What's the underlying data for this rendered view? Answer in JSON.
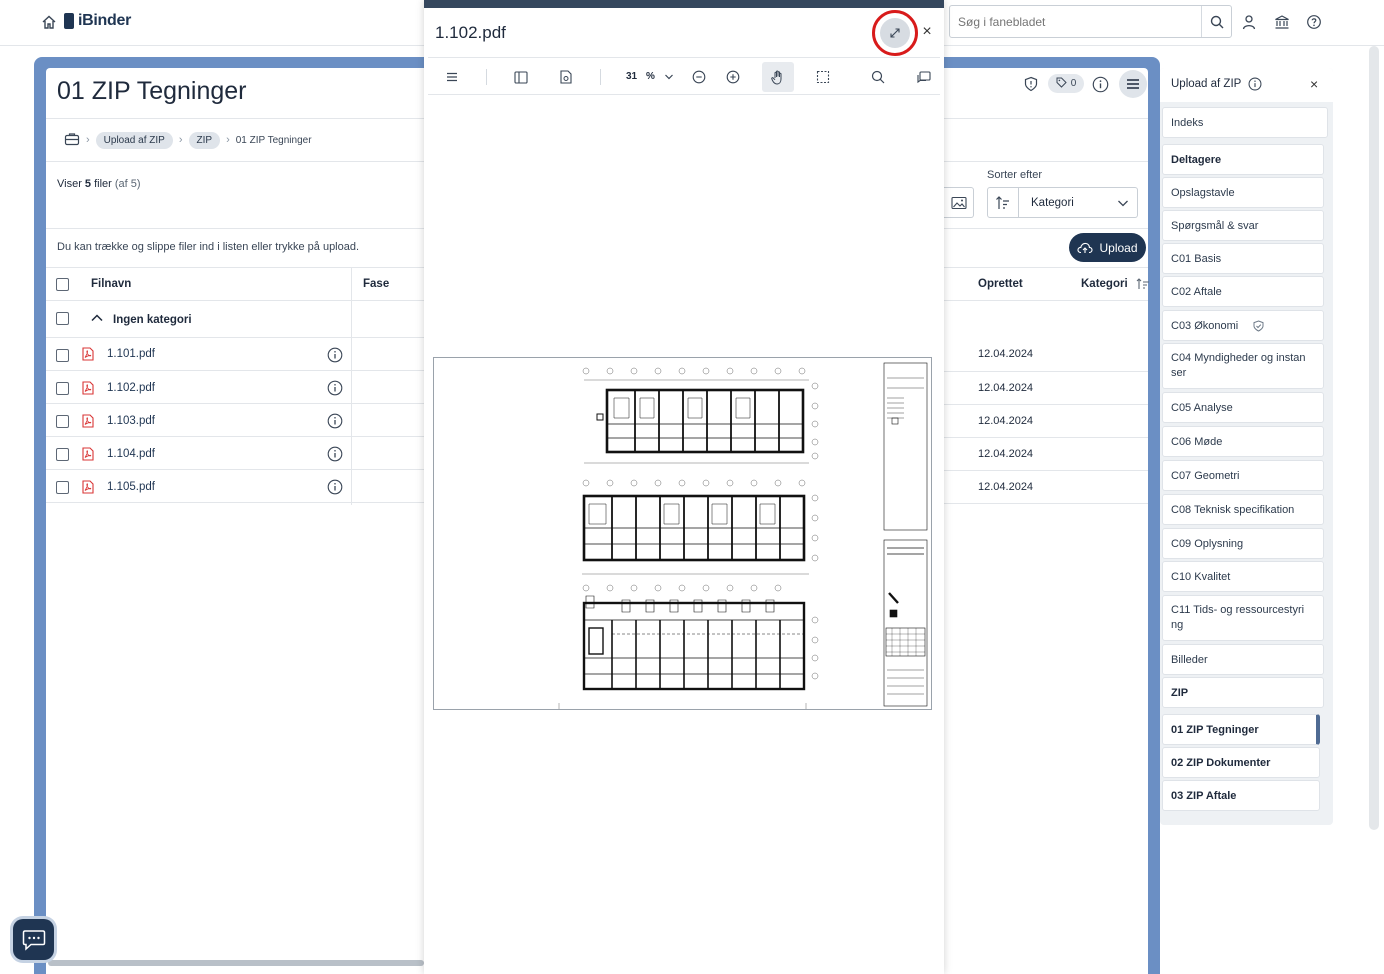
{
  "header": {
    "logo": "iBinder",
    "search_placeholder": "Søg i fanebladet"
  },
  "page": {
    "title": "01 ZIP Tegninger",
    "breadcrumb": [
      "Upload af ZIP",
      "ZIP",
      "01 ZIP Tegninger"
    ],
    "viewing_prefix": "Viser ",
    "viewing_count": "5",
    "viewing_suffix": " filer ",
    "viewing_total": "(af 5)",
    "dnd_hint": "Du kan trække og slippe filer ind i listen eller trykke på upload.",
    "tag_count": "0",
    "sort_label": "Sorter efter",
    "sort_value": "Kategori",
    "upload_label": "Upload"
  },
  "table": {
    "columns": {
      "filename": "Filnavn",
      "phase": "Fase",
      "created": "Oprettet",
      "category": "Kategori"
    },
    "group_label": "Ingen kategori",
    "rows": [
      {
        "name": "1.101.pdf",
        "created": "12.04.2024"
      },
      {
        "name": "1.102.pdf",
        "created": "12.04.2024"
      },
      {
        "name": "1.103.pdf",
        "created": "12.04.2024"
      },
      {
        "name": "1.104.pdf",
        "created": "12.04.2024"
      },
      {
        "name": "1.105.pdf",
        "created": "12.04.2024"
      }
    ]
  },
  "viewer": {
    "title": "1.102.pdf",
    "zoom": "31",
    "zoom_unit": "%"
  },
  "sidebar": {
    "title": "Upload af ZIP",
    "items": [
      {
        "label": "Indeks"
      },
      {
        "label": "Deltagere"
      },
      {
        "label": "Opslagstavle"
      },
      {
        "label": "Spørgsmål & svar"
      },
      {
        "label": "C01 Basis"
      },
      {
        "label": "C02 Aftale"
      },
      {
        "label": "C03 Økonomi"
      },
      {
        "label": "C04 Myndigheder og instan ser"
      },
      {
        "label": "C05 Analyse"
      },
      {
        "label": "C06 Møde"
      },
      {
        "label": "C07 Geometri"
      },
      {
        "label": "C08 Teknisk specifikation"
      },
      {
        "label": "C09 Oplysning"
      },
      {
        "label": "C10 Kvalitet"
      },
      {
        "label": "C11 Tids- og ressourcestyri ng"
      },
      {
        "label": "Billeder"
      },
      {
        "label": "ZIP"
      },
      {
        "label": "01 ZIP Tegninger"
      },
      {
        "label": "02 ZIP Dokumenter"
      },
      {
        "label": "03 ZIP Aftale"
      }
    ]
  },
  "colors": {
    "brand_navy": "#1f3552",
    "frame_blue": "#6b8fc4",
    "highlight_ring": "#d81b1b",
    "pdf_red": "#d93636"
  }
}
